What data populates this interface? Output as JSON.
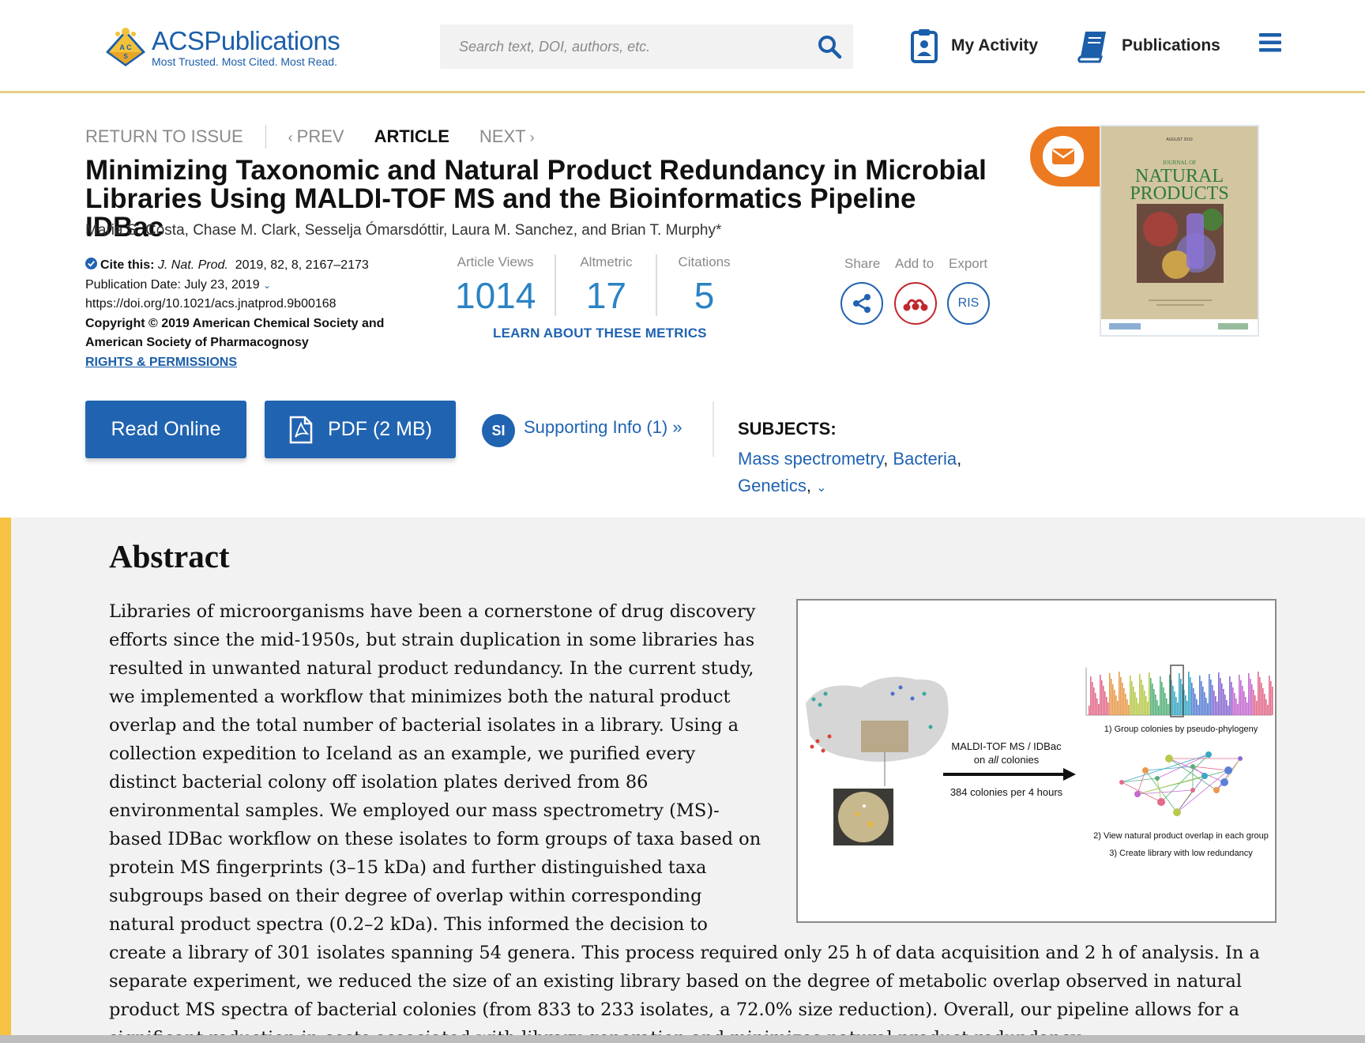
{
  "header": {
    "logo_brand": "ACS",
    "logo_name": "Publications",
    "logo_tagline": "Most Trusted. Most Cited. Most Read.",
    "search_placeholder": "Search text, DOI, authors, etc.",
    "my_activity_label": "My Activity",
    "publications_label": "Publications",
    "icons": {
      "search": "search-icon",
      "activity": "clipboard-user-icon",
      "publications": "book-icon",
      "menu": "hamburger-menu-icon"
    }
  },
  "article_nav": {
    "return_label": "RETURN TO ISSUE",
    "prev_label": "PREV",
    "current_label": "ARTICLE",
    "next_label": "NEXT"
  },
  "article": {
    "title": "Minimizing Taxonomic and Natural Product Redundancy in Microbial Libraries Using MALDI-TOF MS and the Bioinformatics Pipeline IDBac",
    "authors": "Maria S. Costa, Chase M. Clark, Sesselja Ómarsdóttir, Laura M. Sanchez, and Brian T. Murphy*",
    "cite_label": "Cite this:",
    "journal_abbrev": "J. Nat. Prod.",
    "cite_details": "2019, 82, 8, 2167–2173",
    "publication_date": "Publication Date: July 23, 2019",
    "doi": "https://doi.org/10.1021/acs.jnatprod.9b00168",
    "copyright": "Copyright © 2019 American Chemical Society and American Society of Pharmacognosy",
    "rights_label": "RIGHTS & PERMISSIONS"
  },
  "metrics": {
    "items": [
      {
        "label": "Article Views",
        "value": "1014"
      },
      {
        "label": "Altmetric",
        "value": "17"
      },
      {
        "label": "Citations",
        "value": "5"
      }
    ],
    "learn_label": "LEARN ABOUT THESE METRICS"
  },
  "actions": {
    "share_label": "Share",
    "add_to_label": "Add to",
    "export_label": "Export",
    "ris_label": "RIS"
  },
  "buttons": {
    "read_online": "Read Online",
    "pdf": "PDF (2 MB)",
    "si_badge": "SI",
    "supporting_info": "Supporting Info (1) »"
  },
  "subjects": {
    "heading": "SUBJECTS:",
    "items": [
      "Mass spectrometry",
      "Bacteria",
      "Genetics"
    ]
  },
  "cover": {
    "date_line": "AUGUST 2019",
    "journal_line1": "JOURNAL OF",
    "journal_line2": "NATURAL",
    "journal_line3": "PRODUCTS"
  },
  "abstract": {
    "heading": "Abstract",
    "text": "Libraries of microorganisms have been a cornerstone of drug discovery efforts since the mid-1950s, but strain duplication in some libraries has resulted in unwanted natural product redundancy. In the current study, we implemented a workflow that minimizes both the natural product overlap and the total number of bacterial isolates in a library. Using a collection expedition to Iceland as an example, we purified every distinct bacterial colony off isolation plates derived from 86 environmental samples. We employed our mass spectrometry (MS)-based IDBac workflow on these isolates to form groups of taxa based on protein MS fingerprints (3–15 kDa) and further distinguished taxa subgroups based on their degree of overlap within corresponding natural product spectra (0.2–2 kDa). This informed the decision to create a library of 301 isolates spanning 54 genera. This process required only 25 h of data acquisition and 2 h of analysis. In a separate experiment, we reduced the size of an existing library based on the degree of metabolic overlap observed in natural product MS spectra of bacterial colonies (from 833 to 233 isolates, a 72.0% size reduction). Overall, our pipeline allows for a significant reduction in costs associated with library generation and minimizes natural product redundancy.",
    "toc": {
      "arrow_top": "MALDI-TOF MS / IDBac",
      "arrow_mid_pre": "on ",
      "arrow_mid_em": "all",
      "arrow_mid_post": " colonies",
      "arrow_bottom": "384 colonies per 4 hours",
      "step1": "1) Group colonies by pseudo-phylogeny",
      "step2": "2) View natural product overlap in each group",
      "step3": "3) Create library with low redundancy"
    }
  },
  "colors": {
    "brand_blue": "#2063b1",
    "metric_blue": "#2a83c4",
    "accent_orange": "#ec7a21",
    "accent_yellow": "#f5c242"
  }
}
